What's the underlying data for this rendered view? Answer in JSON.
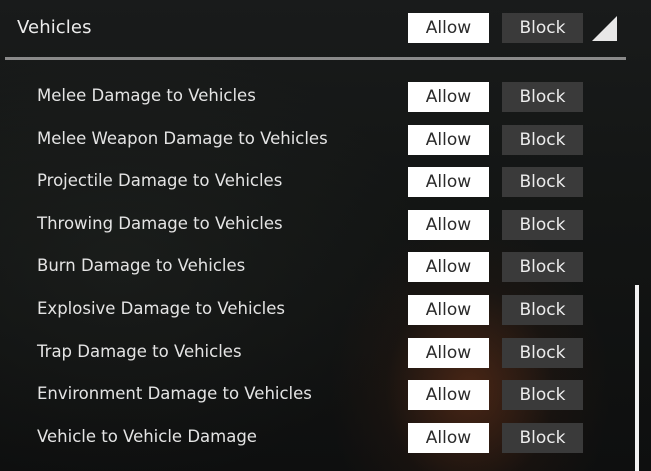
{
  "section": {
    "title": "Vehicles",
    "allow_label": "Allow",
    "block_label": "Block",
    "collapse_icon": "corner-triangle-icon"
  },
  "rows": [
    {
      "label": "Melee Damage to Vehicles",
      "allow_label": "Allow",
      "block_label": "Block"
    },
    {
      "label": "Melee Weapon Damage to Vehicles",
      "allow_label": "Allow",
      "block_label": "Block"
    },
    {
      "label": "Projectile Damage to Vehicles",
      "allow_label": "Allow",
      "block_label": "Block"
    },
    {
      "label": "Throwing Damage to Vehicles",
      "allow_label": "Allow",
      "block_label": "Block"
    },
    {
      "label": "Burn Damage to Vehicles",
      "allow_label": "Allow",
      "block_label": "Block"
    },
    {
      "label": "Explosive Damage to Vehicles",
      "allow_label": "Allow",
      "block_label": "Block"
    },
    {
      "label": "Trap Damage to Vehicles",
      "allow_label": "Allow",
      "block_label": "Block"
    },
    {
      "label": "Environment Damage to Vehicles",
      "allow_label": "Allow",
      "block_label": "Block"
    },
    {
      "label": "Vehicle to Vehicle Damage",
      "allow_label": "Allow",
      "block_label": "Block"
    }
  ],
  "colors": {
    "allow_bg": "#ffffff",
    "block_bg": "#3a3a3a",
    "divider": "#8a8a8a",
    "text": "#e4e4e4"
  }
}
